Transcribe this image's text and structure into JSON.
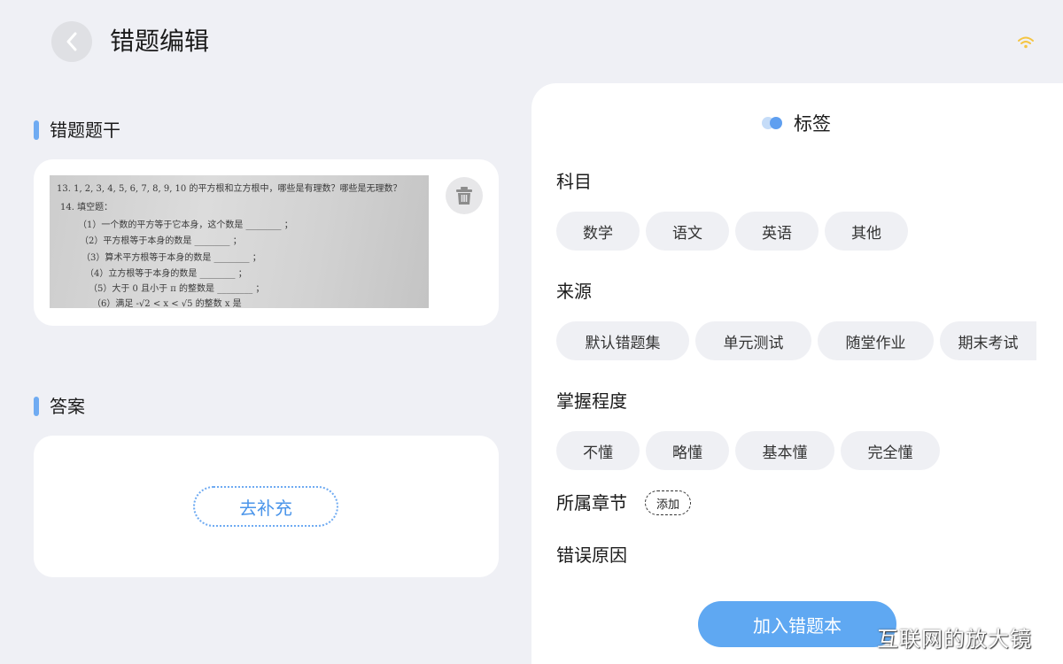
{
  "header": {
    "title": "错题编辑"
  },
  "stem": {
    "title": "错题题干",
    "photo_lines": [
      "13. 1, 2, 3, 4, 5, 6, 7, 8, 9, 10 的平方根和立方根中，哪些是有理数？哪些是无理数？",
      "14. 填空题：",
      "（1）一个数的平方等于它本身，这个数是 ________ ；",
      "（2）平方根等于本身的数是 ________ ；",
      "（3）算术平方根等于本身的数是 ________ ；",
      "（4）立方根等于本身的数是 ________ ；",
      "（5）大于 0 且小于 π 的整数是 ________ ；",
      "（6）满足 -√2 < x < √5 的整数 x 是 ________"
    ]
  },
  "answer": {
    "title": "答案",
    "fill_label": "去补充"
  },
  "tags": {
    "title": "标签",
    "subject": {
      "label": "科目",
      "options": [
        "数学",
        "语文",
        "英语",
        "其他"
      ]
    },
    "source": {
      "label": "来源",
      "options": [
        "默认错题集",
        "单元测试",
        "随堂作业",
        "期末考试"
      ]
    },
    "mastery": {
      "label": "掌握程度",
      "options": [
        "不懂",
        "略懂",
        "基本懂",
        "完全懂"
      ]
    },
    "chapter": {
      "label": "所属章节",
      "add_label": "添加"
    },
    "reason": {
      "label": "错误原因"
    }
  },
  "submit_label": "加入错题本",
  "watermark": "互联网的放大镜",
  "colors": {
    "accent": "#5fa8f2",
    "background": "#eff0f5",
    "chip_bg": "#eff0f4",
    "wifi": "#f5c542"
  },
  "icons": {
    "back": "chevron-left-icon",
    "trash": "trash-icon",
    "wifi": "wifi-icon",
    "tag": "tag-dots-icon"
  }
}
